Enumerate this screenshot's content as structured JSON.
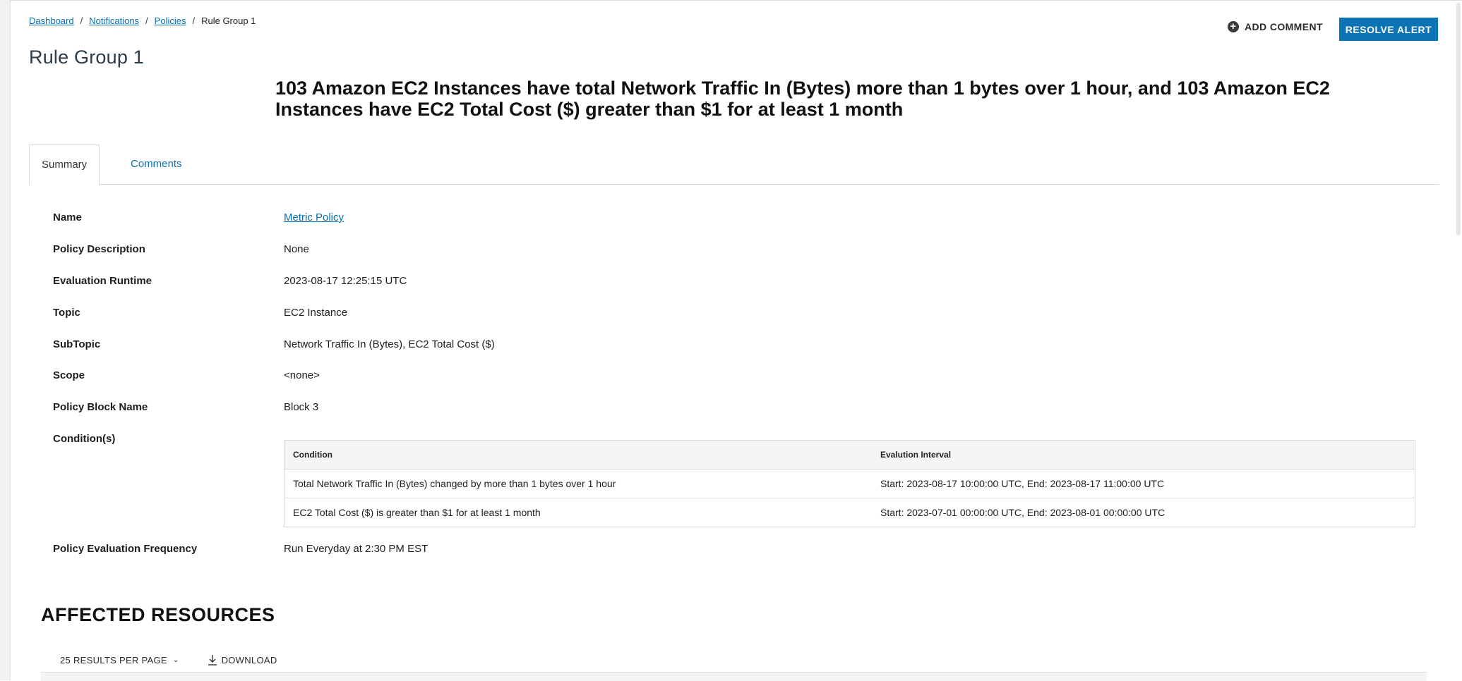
{
  "breadcrumb": {
    "items": [
      "Dashboard",
      "Notifications",
      "Policies"
    ],
    "separator": "/",
    "current": "Rule Group 1"
  },
  "page_title": "Rule Group 1",
  "header_actions": {
    "add_comment": "ADD COMMENT",
    "add_comment_icon": "plus-circle-icon",
    "resolve_alert": "RESOLVE ALERT",
    "accent_color": "#0b74b4"
  },
  "alert_summary": "103 Amazon EC2 Instances have total Network Traffic In (Bytes) more than 1 bytes over 1 hour, and 103 Amazon EC2 Instances have EC2 Total Cost ($) greater than $1 for at least 1 month",
  "tabs": [
    {
      "label": "Summary",
      "active": true
    },
    {
      "label": "Comments",
      "active": false
    }
  ],
  "details": {
    "name": {
      "label": "Name",
      "value": "Metric Policy"
    },
    "policy_description": {
      "label": "Policy Description",
      "value": "None"
    },
    "evaluation_runtime": {
      "label": "Evaluation Runtime",
      "value": "2023-08-17 12:25:15 UTC"
    },
    "topic": {
      "label": "Topic",
      "value": "EC2 Instance"
    },
    "subtopic": {
      "label": "SubTopic",
      "value": "Network Traffic In (Bytes), EC2 Total Cost ($)"
    },
    "scope": {
      "label": "Scope",
      "value": "<none>"
    },
    "policy_block_name": {
      "label": "Policy Block Name",
      "value": "Block 3"
    },
    "conditions": {
      "label": "Condition(s)"
    },
    "policy_evaluation_frequency": {
      "label": "Policy Evaluation Frequency",
      "value": "Run Everyday at 2:30 PM EST"
    }
  },
  "conditions_table": {
    "headers": [
      "Condition",
      "Evalution Interval"
    ],
    "rows": [
      [
        "Total Network Traffic In (Bytes) changed by more than 1 bytes over 1 hour",
        "Start: 2023-08-17 10:00:00 UTC, End: 2023-08-17 11:00:00 UTC"
      ],
      [
        "EC2 Total Cost ($) is greater than $1 for at least 1 month",
        "Start: 2023-07-01 00:00:00 UTC, End: 2023-08-01 00:00:00 UTC"
      ]
    ]
  },
  "affected_resources": {
    "title": "AFFECTED RESOURCES",
    "per_page": "25 RESULTS PER PAGE",
    "download": "DOWNLOAD"
  }
}
